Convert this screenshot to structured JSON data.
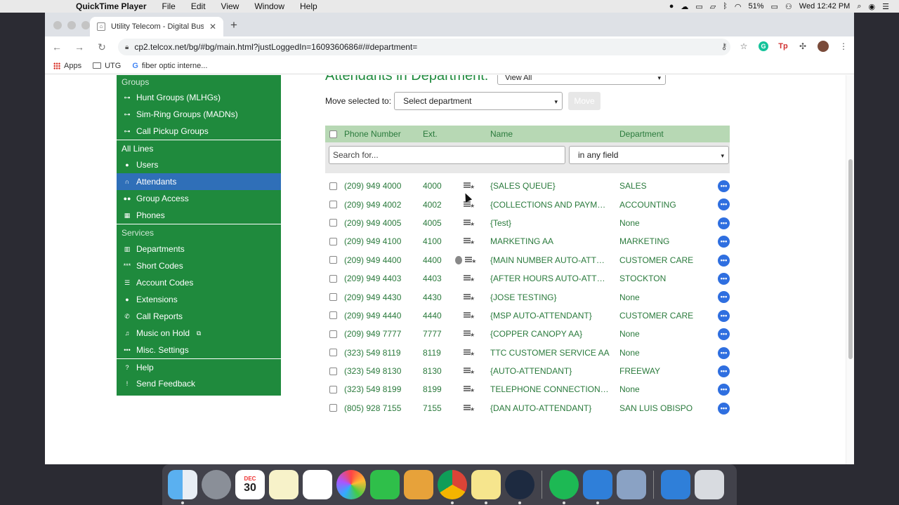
{
  "menubar": {
    "app_name": "QuickTime Player",
    "items": [
      "File",
      "Edit",
      "View",
      "Window",
      "Help"
    ],
    "battery": "51%",
    "clock": "Wed 12:42 PM"
  },
  "browser": {
    "tab_title": "Utility Telecom - Digital Busine",
    "url": "cp2.telcox.net/bg/#bg/main.html?justLoggedIn=1609360686#/#department=",
    "bookmarks": [
      "Apps",
      "UTG",
      "fiber optic interne..."
    ]
  },
  "sidebar": {
    "groups_label": "Groups",
    "group_items": [
      "Hunt Groups (MLHGs)",
      "Sim-Ring Groups (MADNs)",
      "Call Pickup Groups"
    ],
    "all_lines_label": "All Lines",
    "line_items": [
      "Users",
      "Attendants",
      "Group Access",
      "Phones"
    ],
    "services_label": "Services",
    "service_items": [
      "Departments",
      "Short Codes",
      "Account Codes",
      "Extensions",
      "Call Reports",
      "Music on Hold",
      "Misc. Settings"
    ],
    "help_items": [
      "Help",
      "Send Feedback"
    ],
    "active_item": "Attendants"
  },
  "main": {
    "heading": "Attendants in Department:",
    "view_select": "View All",
    "move_label": "Move selected to:",
    "move_select": "Select department",
    "move_button": "Move",
    "columns": {
      "phone": "Phone Number",
      "ext": "Ext.",
      "name": "Name",
      "dept": "Department"
    },
    "search_placeholder": "Search for...",
    "search_field": "in any field",
    "rows": [
      {
        "phone": "(209) 949 4000",
        "ext": "4000",
        "name": "{SALES QUEUE}",
        "dept": "SALES"
      },
      {
        "phone": "(209) 949 4002",
        "ext": "4002",
        "name": "{COLLECTIONS AND PAYM…",
        "dept": "ACCOUNTING"
      },
      {
        "phone": "(209) 949 4005",
        "ext": "4005",
        "name": "{Test}",
        "dept": "None"
      },
      {
        "phone": "(209) 949 4100",
        "ext": "4100",
        "name": "MARKETING AA",
        "dept": "MARKETING"
      },
      {
        "phone": "(209) 949 4400",
        "ext": "4400",
        "name": "{MAIN NUMBER AUTO-ATT…",
        "dept": "CUSTOMER CARE"
      },
      {
        "phone": "(209) 949 4403",
        "ext": "4403",
        "name": "{AFTER HOURS AUTO-ATT…",
        "dept": "STOCKTON"
      },
      {
        "phone": "(209) 949 4430",
        "ext": "4430",
        "name": "{JOSE TESTING}",
        "dept": "None"
      },
      {
        "phone": "(209) 949 4440",
        "ext": "4440",
        "name": "{MSP AUTO-ATTENDANT}",
        "dept": "CUSTOMER CARE"
      },
      {
        "phone": "(209) 949 7777",
        "ext": "7777",
        "name": "{COPPER CANOPY AA}",
        "dept": "None"
      },
      {
        "phone": "(323) 549 8119",
        "ext": "8119",
        "name": "TTC CUSTOMER SERVICE AA",
        "dept": "None"
      },
      {
        "phone": "(323) 549 8130",
        "ext": "8130",
        "name": "{AUTO-ATTENDANT}",
        "dept": "FREEWAY"
      },
      {
        "phone": "(323) 549 8199",
        "ext": "8199",
        "name": "TELEPHONE CONNECTION…",
        "dept": "None"
      },
      {
        "phone": "(805) 928 7155",
        "ext": "7155",
        "name": "{DAN AUTO-ATTENDANT}",
        "dept": "SAN LUIS OBISPO"
      }
    ]
  },
  "dock": {
    "calendar_month": "DEC",
    "calendar_day": "30"
  }
}
